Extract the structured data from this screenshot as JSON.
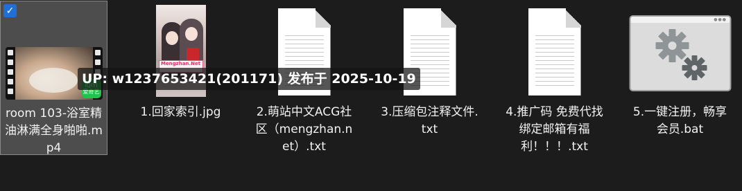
{
  "files": [
    {
      "name": "room 103-浴室精油淋满全身啪啪.mp4",
      "selected": true
    },
    {
      "name": "1.回家索引.jpg"
    },
    {
      "name": "2.萌站中文ACG社区（mengzhan.net）.txt"
    },
    {
      "name": "3.压缩包注释文件.txt"
    },
    {
      "name": "4.推广码 免费代找 绑定邮箱有福利！！！.txt"
    },
    {
      "name": "5.一键注册，畅享会员.bat"
    }
  ],
  "thumbnails": {
    "video_badge": "iQIYI 爱奇艺",
    "jpg_banner": "Mengzhan.Net"
  },
  "overlay": {
    "text": "UP: w1237653421(201171) 发布于 2025-10-19"
  },
  "checkbox_icon": "checkmark-icon",
  "colors": {
    "background": "#1c1c1c",
    "selection": "#4d4d4d",
    "check_accent": "#1f6fd6"
  }
}
